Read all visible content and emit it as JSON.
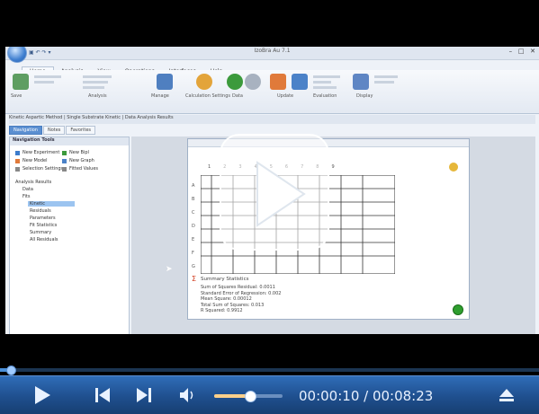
{
  "app": {
    "title": "IzoBra Au 7.1",
    "ribbon_tabs": [
      "Home",
      "Analysis",
      "View",
      "Operations",
      "Interfaces",
      "Help"
    ],
    "ribbon_groups": [
      {
        "label": "Save"
      },
      {
        "label": "Analysis"
      },
      {
        "label": "Manage"
      },
      {
        "label": "Calculation Settings"
      },
      {
        "label": "Data"
      },
      {
        "label": "Update"
      },
      {
        "label": "Evaluation"
      },
      {
        "label": "Display"
      }
    ],
    "doc_tabs": "Kinetic Aspartic Method | Single Substrate Kinetic | Data Analysis Results",
    "sub_tabs": [
      "Navigation",
      "Notes",
      "Favorites"
    ]
  },
  "navigation": {
    "header": "Navigation Tools",
    "items": [
      "New Experiment",
      "New Bipl",
      "New Model",
      "New Graph",
      "Selection Settings",
      "Fitted Values"
    ],
    "tree": [
      "Analysis Results",
      "Data",
      "Fits",
      "Kinetic",
      "Residuals",
      "Parameters",
      "Fit Statistics",
      "Summary",
      "All Residuals"
    ]
  },
  "worksheet": {
    "summary_title": "Summary Statistics",
    "summary_lines": [
      "Sum of Squares Residual: 0.0011",
      "Standard Error of Regression: 0.002",
      "Mean Square: 0.00012",
      "Total Sum of Squares: 0.013",
      "R Squared: 0.9912"
    ]
  },
  "player": {
    "current_time": "00:00:10",
    "total_time": "00:08:23",
    "time_display": "00:00:10 / 00:08:23",
    "progress": 0.02,
    "volume": 0.52,
    "buttons": [
      "play-button",
      "previous-button",
      "next-button",
      "volume-button",
      "eject-button"
    ]
  },
  "colors": {
    "accent": "#2f6db8",
    "control_bar_dark": "#173f72",
    "progress_fill": "#4a90d9",
    "volume_fill": "#ffd08a"
  }
}
